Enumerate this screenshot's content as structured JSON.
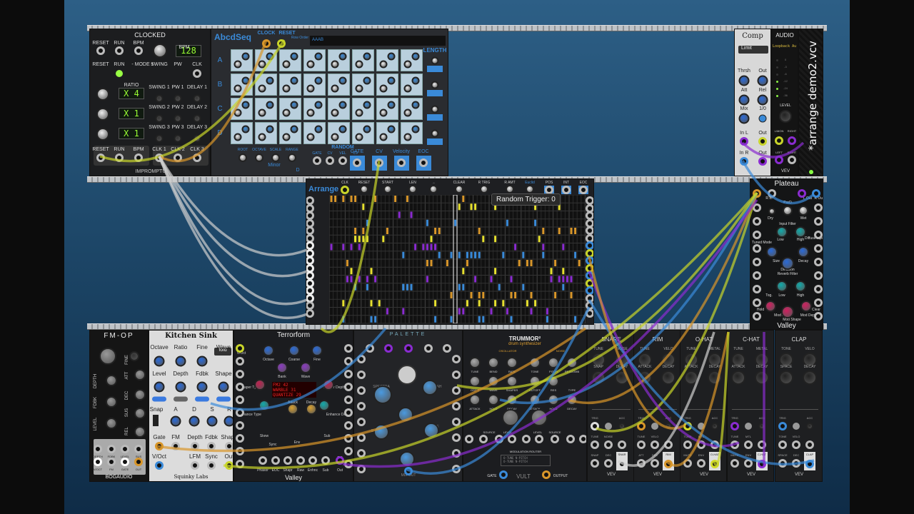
{
  "window": {
    "patch_name": "*arrange demo2.vcv"
  },
  "clocked": {
    "title": "CLOCKED",
    "brand": "IMPROMPTU",
    "bpm_value": "128",
    "ratios": [
      "X 4",
      "X 1",
      "X 1"
    ],
    "labels": [
      "RESET",
      "RUN",
      "BPM",
      "BPM",
      "RESET",
      "RUN",
      "- MODE +",
      "SWING",
      "PW",
      "CLK",
      "RATIO",
      "SWING 1",
      "PW 1",
      "DELAY 1",
      "SWING 2",
      "PW 2",
      "DELAY 2",
      "SWING 3",
      "PW 3",
      "DELAY 3",
      "RESET",
      "RUN",
      "BPM",
      "CLK 1",
      "CLK 2",
      "CLK 3"
    ]
  },
  "abcdseq": {
    "title": "AbcdSeq",
    "clock": "CLOCK",
    "reset": "RESET",
    "row_order_label": "Row Order",
    "row_order": "AAAB",
    "rows": [
      "A",
      "B",
      "C",
      "D"
    ],
    "length": "LENGTH",
    "bottom_labels": [
      "ROOT",
      "OCTAVE",
      "SCALE",
      "RANGE",
      "GATE",
      "CV",
      "VEL",
      "CV"
    ],
    "root_value": "D",
    "scale_value": "Minor",
    "random": "RANDOM",
    "outputs": [
      "GATE",
      "CV",
      "Velocity",
      "EOC"
    ]
  },
  "comp": {
    "title": "Comp",
    "mode": "Limit",
    "labels": [
      "Thrsh",
      "Out",
      "Att",
      "Rel",
      "Mix",
      "1/0",
      "In L",
      "Out",
      "In R",
      "Out"
    ]
  },
  "audio": {
    "title": "AUDIO",
    "device": "Loopback Au",
    "meter": [
      "0",
      "-3",
      "-6",
      "-12",
      "-24",
      "-36"
    ],
    "level": "LEVEL",
    "labels": [
      "L/MON",
      "RIGHT",
      "LEFT",
      "RIGHT"
    ],
    "brand": "VEV"
  },
  "arrange": {
    "title": "Arrange",
    "controls": [
      "CLK",
      "RESET",
      "START",
      "LEN",
      "→",
      "CLEAR",
      "R TRIG",
      "R AMT",
      "Euclid",
      "POS",
      "INT",
      "EOC"
    ],
    "tooltip": "Random Trigger: 0"
  },
  "plateau": {
    "title": "Plateau",
    "brand": "Valley",
    "labels": [
      "R In",
      "PreD",
      "L Out",
      "R Out",
      "Dry",
      "Wet",
      "Input Filter",
      "Low",
      "High",
      "Diffuse Input",
      "Tuned Mode",
      "Size",
      "Diffusion",
      "Decay",
      "Reverb Filter",
      "Tog.",
      "Low",
      "High",
      "Hold",
      "Clear",
      "Mod Rate",
      "Mod Shape",
      "Mod Depth"
    ]
  },
  "fmop": {
    "title": "FM-OP",
    "brand": "BOGAUDIO",
    "labels": [
      "DEPTH",
      "FDBK",
      "LEVEL",
      "FINE",
      "ATT",
      "DEC",
      "SUS",
      "REL"
    ],
    "jacks": [
      "DEPTH",
      "FDBK",
      "LEVEL",
      "SUS",
      "V/OCT",
      "FM",
      "GATE",
      "OUT"
    ]
  },
  "kitchensink": {
    "title": "Kitchen Sink",
    "brand": "Squinky Labs",
    "wave": "fold",
    "labels": [
      "Octave",
      "Ratio",
      "Fine",
      "Wave",
      "Level",
      "Depth",
      "Fdbk",
      "Shape",
      "Snap",
      "A",
      "D",
      "S",
      "R",
      "Gate",
      "FM",
      "Depth",
      "Fdbk",
      "Shape",
      "V/Oct",
      "LFM",
      "Sync",
      "Out"
    ]
  },
  "terrorform": {
    "title": "Terrorform",
    "brand": "Valley",
    "display": [
      "FM2  42",
      "WARBLE  31",
      "QUANTIZE  29"
    ],
    "labels": [
      "V/Oct",
      "Octave",
      "Coarse",
      "Fine",
      "Bank",
      "Wave",
      "Shaper Type",
      "Shaper Depth",
      "Attack",
      "Decay",
      "Enhance Type",
      "Enhance Depth",
      "Skew",
      "Env",
      "Sync",
      "Sub",
      "Phasor",
      "EOC",
      "Shapr",
      "Raw",
      "Enhnc",
      "Sub",
      "Out",
      "VCA",
      "FM"
    ]
  },
  "palette": {
    "title": "PALETTE",
    "labels": [
      "SPECTRA",
      "YOW-WAH",
      "SHAPE",
      "TUNE",
      "MIX OUT"
    ]
  },
  "trummor": {
    "title": "TRUMMOR²",
    "subtitle": "drum synthesizer",
    "oscillator": "OSCILLATOR",
    "noise": "NOISE",
    "router": "MODULATION ROUTER",
    "gate": "GATE",
    "output": "OUTPUT",
    "brand": "VULT",
    "labels": [
      "TUNE",
      "BEND",
      "RATE",
      "TONE",
      "PITCH",
      "RESCOMB",
      "OSC 2",
      "WAVE",
      "SHAPER",
      "CUTOFF",
      "RES",
      "TYPE",
      "ATTACK",
      "HOLD",
      "DECAY",
      "ATTACK",
      "HOLD",
      "DECAY",
      "SOURCE",
      "LEVEL",
      "LEVEL",
      "SOURCE"
    ],
    "router_rows": [
      "O-TUNE   N-PITCH",
      "O-TUNE   N-PITCH"
    ]
  },
  "drums": [
    {
      "title": "SNARE",
      "k": [
        "TUNE",
        "NOISE",
        "SNAP",
        "DECAY"
      ],
      "j": [
        "TRIG",
        "ACC",
        "TUNE",
        "NOISE",
        "SNAP",
        "DEC",
        "SNAR"
      ],
      "color": "#dddddd"
    },
    {
      "title": "RIM",
      "k": [
        "TUNE",
        "VELO",
        "ATTACK",
        "DECAY"
      ],
      "j": [
        "TRIG",
        "ACC",
        "TUNE",
        "VELO",
        "ATT",
        "DEC",
        "RIM"
      ],
      "color": "#d8962a"
    },
    {
      "title": "O-HAT",
      "k": [
        "TUNE",
        "METAL",
        "ATTACK",
        "DECAY"
      ],
      "j": [
        "TRIG",
        "ACC",
        "TUNE",
        "MTL",
        "MUTE",
        "ENV",
        "O-HAT"
      ],
      "color": "#d4dc2a"
    },
    {
      "title": "C-HAT",
      "k": [
        "TUNE",
        "METAL",
        "ATTACK",
        "DECAY"
      ],
      "j": [
        "TRIG",
        "ACC",
        "TUNE",
        "MTL",
        "MUTE",
        "ENV",
        "C-HAT"
      ],
      "color": "#8a2cd0"
    },
    {
      "title": "CLAP",
      "k": [
        "TONE",
        "VELO",
        "SPACE",
        "DECAY"
      ],
      "j": [
        "TRIG",
        "ACC",
        "TONE",
        "VELO",
        "SPACE",
        "DEC",
        "CLAP"
      ],
      "color": "#3a8ad8"
    }
  ],
  "drum_brand": "VEV",
  "colors": {
    "cable_yellow": "#c8d42a",
    "cable_orange": "#d8962a",
    "cable_purple": "#8a2cd0",
    "cable_blue": "#3a8ad8",
    "cable_white": "#d8d8d8",
    "knob_blue": "#2a6ad8",
    "accent_blue": "#3a8ad8"
  }
}
